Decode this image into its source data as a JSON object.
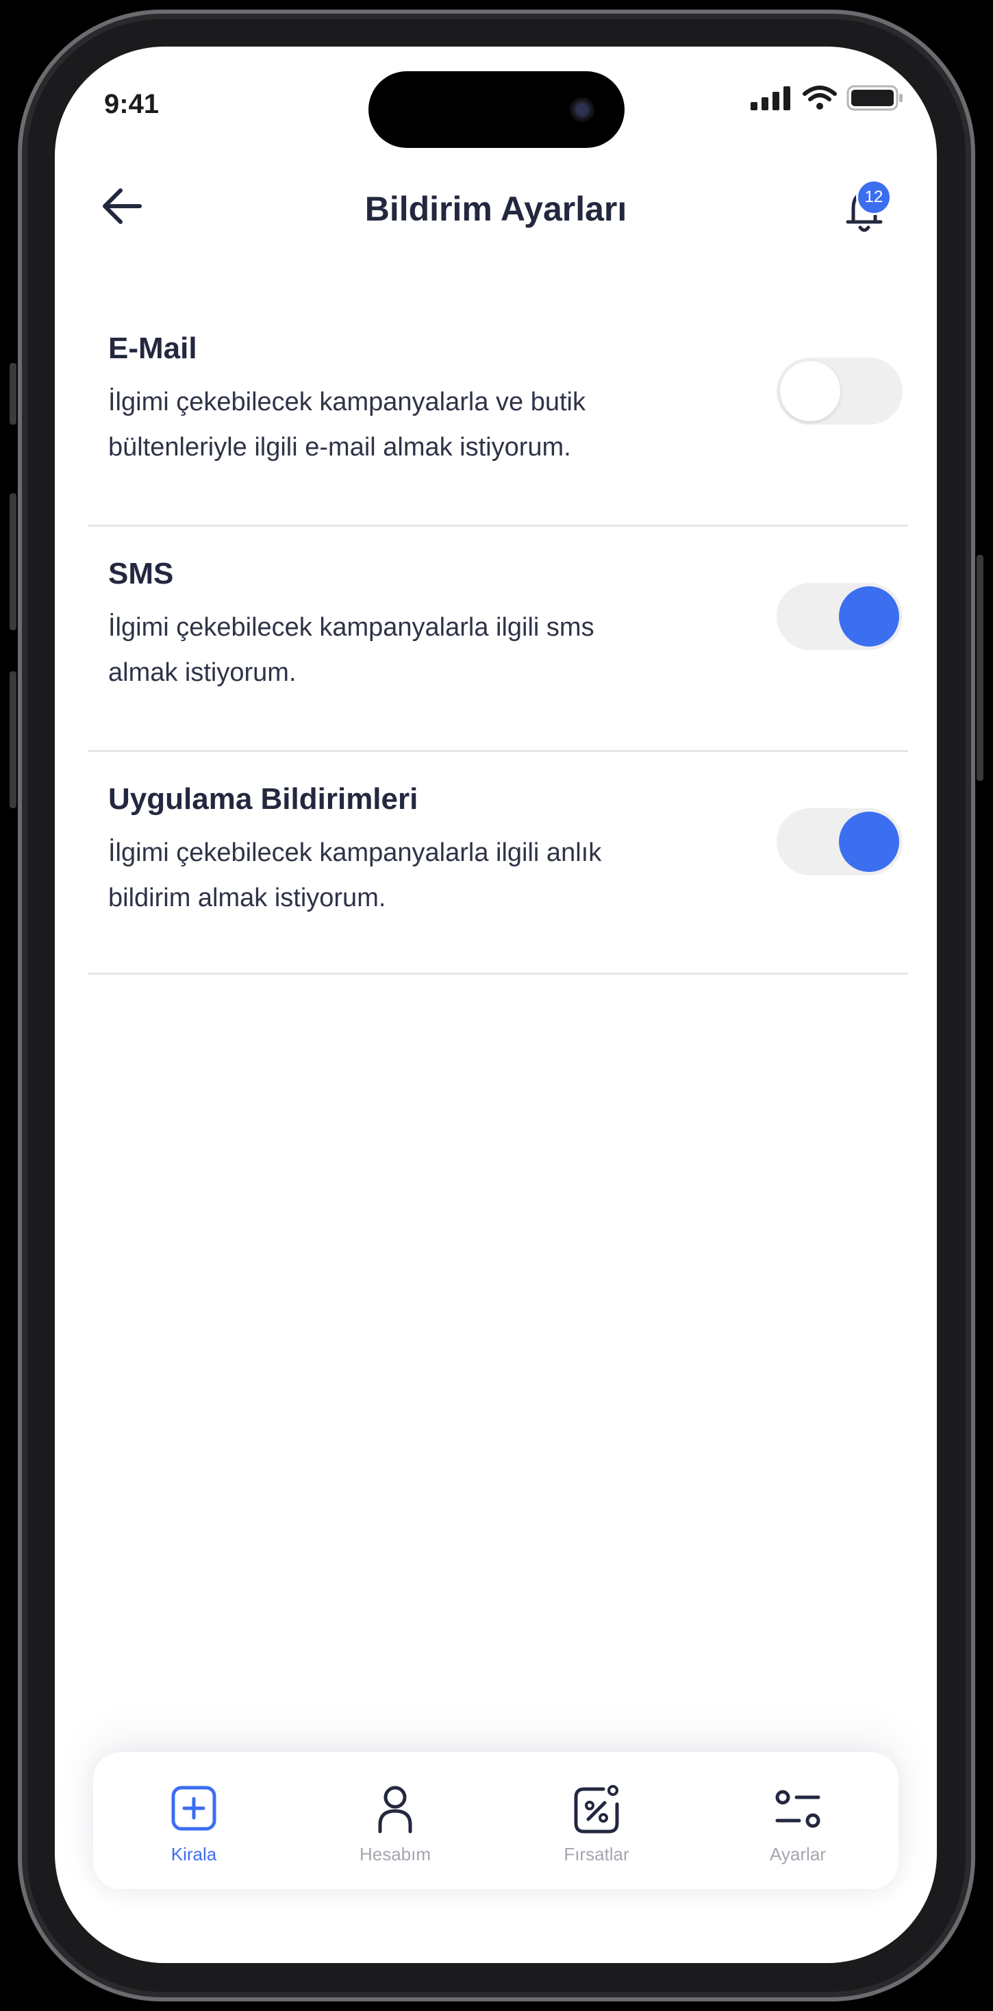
{
  "status_bar": {
    "time": "9:41"
  },
  "header": {
    "title": "Bildirim Ayarları",
    "notification_count": "12",
    "back_icon": "arrow-left-icon",
    "bell_icon": "bell-icon"
  },
  "settings": [
    {
      "title": "E-Mail",
      "description": "İlgimi çekebilecek kampanyalarla ve butik bültenleriyle ilgili e-mail almak istiyorum.",
      "enabled": false
    },
    {
      "title": "SMS",
      "description": "İlgimi çekebilecek kampanyalarla ilgili sms almak istiyorum.",
      "enabled": true
    },
    {
      "title": "Uygulama Bildirimleri",
      "description": "İlgimi çekebilecek kampanyalarla ilgili anlık bildirim almak istiyorum.",
      "enabled": true
    }
  ],
  "tab_bar": {
    "items": [
      {
        "label": "Kirala",
        "icon": "plus-square-icon",
        "active": true
      },
      {
        "label": "Hesabım",
        "icon": "user-icon",
        "active": false
      },
      {
        "label": "Fırsatlar",
        "icon": "discount-icon",
        "active": false
      },
      {
        "label": "Ayarlar",
        "icon": "settings-sliders-icon",
        "active": false
      }
    ]
  },
  "colors": {
    "accent": "#3c6ef0",
    "title_text": "#23283f",
    "inactive_tab": "#a4a6b0",
    "toggle_track": "#efefef"
  }
}
